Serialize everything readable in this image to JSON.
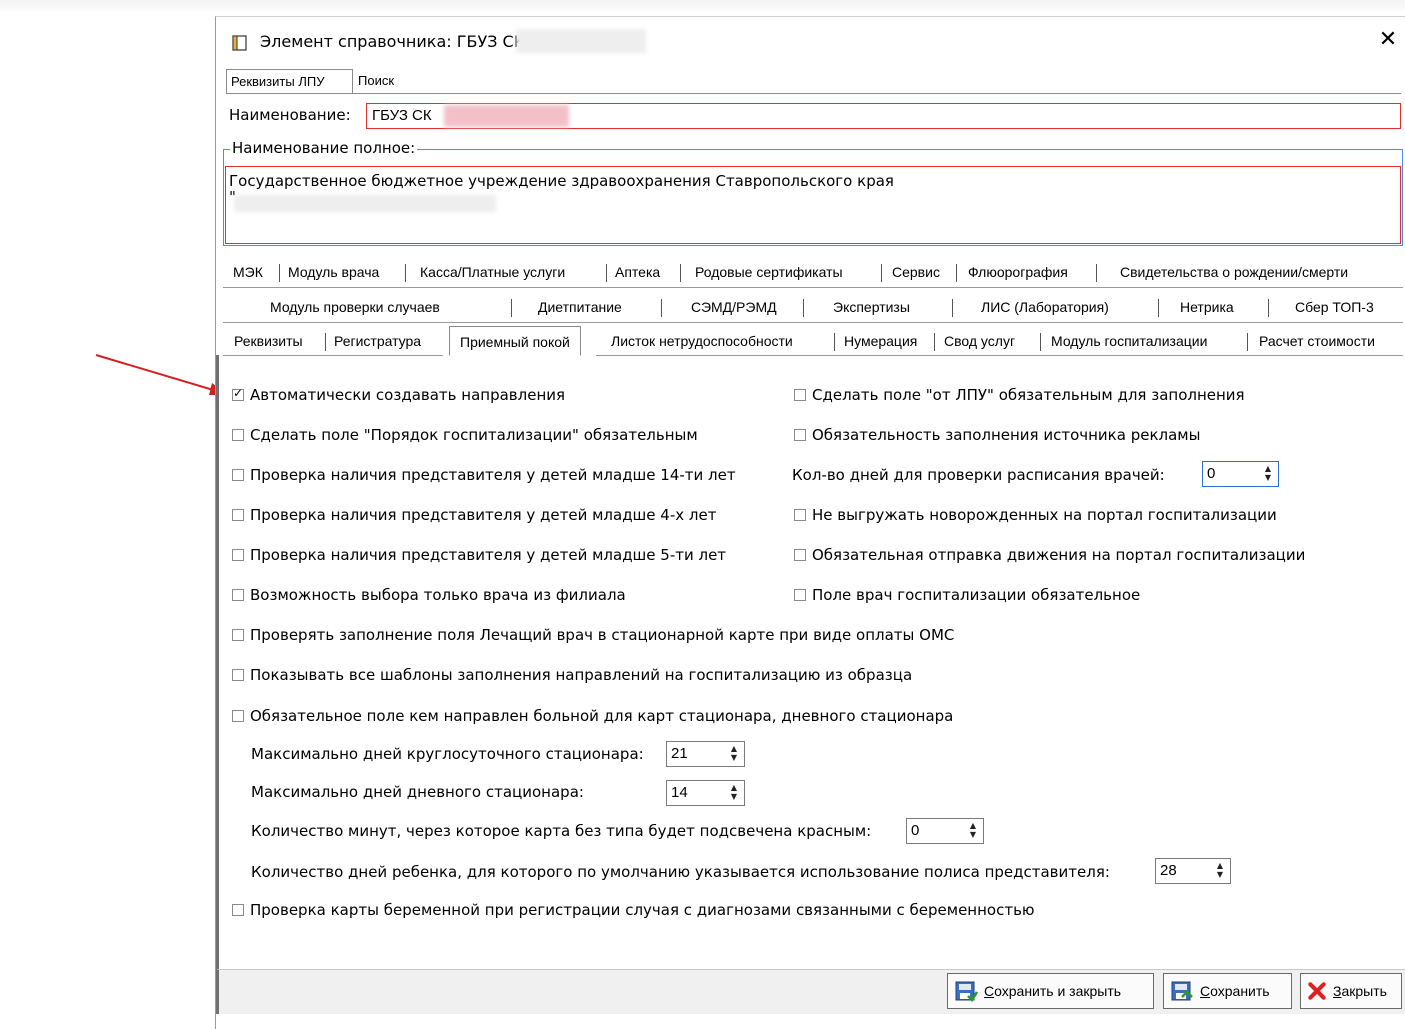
{
  "window": {
    "title": "Элемент справочника: ГБУЗ СК",
    "close_glyph": "✕"
  },
  "top_tabs": [
    "Реквизиты ЛПУ",
    "Поиск"
  ],
  "name": {
    "label": "Наименование:",
    "value": "ГБУЗ СК"
  },
  "full_name": {
    "legend": "Наименование полное:",
    "value": "Государственное бюджетное учреждение здравоохранения Ставропольского края",
    "second_line": "\""
  },
  "tab_row1": [
    "МЭК",
    "Модуль врача",
    "Касса/Платные услуги",
    "Аптека",
    "Родовые сертификаты",
    "Сервис",
    "Флюорография",
    "Свидетельства о рождении/смерти"
  ],
  "tab_row2": [
    "Модуль проверки случаев",
    "Диетпитание",
    "СЭМД/РЭМД",
    "Экспертизы",
    "ЛИС (Лаборатория)",
    "Нетрика",
    "Сбер ТОП-3"
  ],
  "tab_row3": [
    "Реквизиты",
    "Регистратура",
    "Приемный покой",
    "Листок нетрудоспособности",
    "Нумерация",
    "Свод услуг",
    "Модуль госпитализации",
    "Расчет стоимости"
  ],
  "active_tab": "Приемный покой",
  "left_checkboxes": [
    {
      "label": "Автоматически создавать направления",
      "checked": true
    },
    {
      "label": "Сделать поле \"Порядок госпитализации\" обязательным",
      "checked": false
    },
    {
      "label": "Проверка наличия представителя у детей младше 14-ти лет",
      "checked": false
    },
    {
      "label": "Проверка наличия представителя у детей младше 4-х лет",
      "checked": false
    },
    {
      "label": "Проверка наличия представителя у детей младше 5-ти лет",
      "checked": false
    },
    {
      "label": "Возможность выбора только врача из филиала",
      "checked": false
    }
  ],
  "right_checkboxes": [
    {
      "label": "Сделать поле \"от ЛПУ\" обязательным для заполнения",
      "checked": false
    },
    {
      "label": "Обязательность заполнения источника рекламы",
      "checked": false
    },
    {
      "label": "Не выгружать новорожденных на портал госпитализации",
      "checked": false
    },
    {
      "label": "Обязательная отправка движения на портал госпитализации",
      "checked": false
    },
    {
      "label": "Поле врач госпитализации обязательное",
      "checked": false
    }
  ],
  "days_check": {
    "label": "Кол-во дней для проверки расписания врачей:",
    "value": "0"
  },
  "full_checkboxes": [
    {
      "label": "Проверять заполнение поля Лечащий врач в стационарной карте при виде оплаты ОМС",
      "checked": false
    },
    {
      "label": "Показывать все шаблоны заполнения направлений на госпитализацию из образца",
      "checked": false
    },
    {
      "label": "Обязательное поле кем направлен больной для карт стационара, дневного стационара",
      "checked": false
    }
  ],
  "spinners": [
    {
      "label": "Максимально дней круглосуточного стационара:",
      "value": "21"
    },
    {
      "label": "Максимально дней дневного стационара:",
      "value": "14"
    },
    {
      "label": "Количество минут, через которое карта без типа будет подсвечена красным:",
      "value": "0"
    },
    {
      "label": "Количество дней ребенка, для которого по умолчанию указывается использование полиса представителя:",
      "value": "28"
    }
  ],
  "last_checkbox": {
    "label": "Проверка карты беременной при регистрации случая с диагнозами связанными с беременностью",
    "checked": false
  },
  "buttons": {
    "save_close_u": "С",
    "save_close_rest": "охранить и закрыть",
    "save_u": "С",
    "save_rest": "охранить",
    "close_u": "З",
    "close_rest": "акрыть"
  },
  "colors": {
    "accent": "#2b6fd6",
    "error_border": "#e03030",
    "arrow": "#d42020"
  }
}
